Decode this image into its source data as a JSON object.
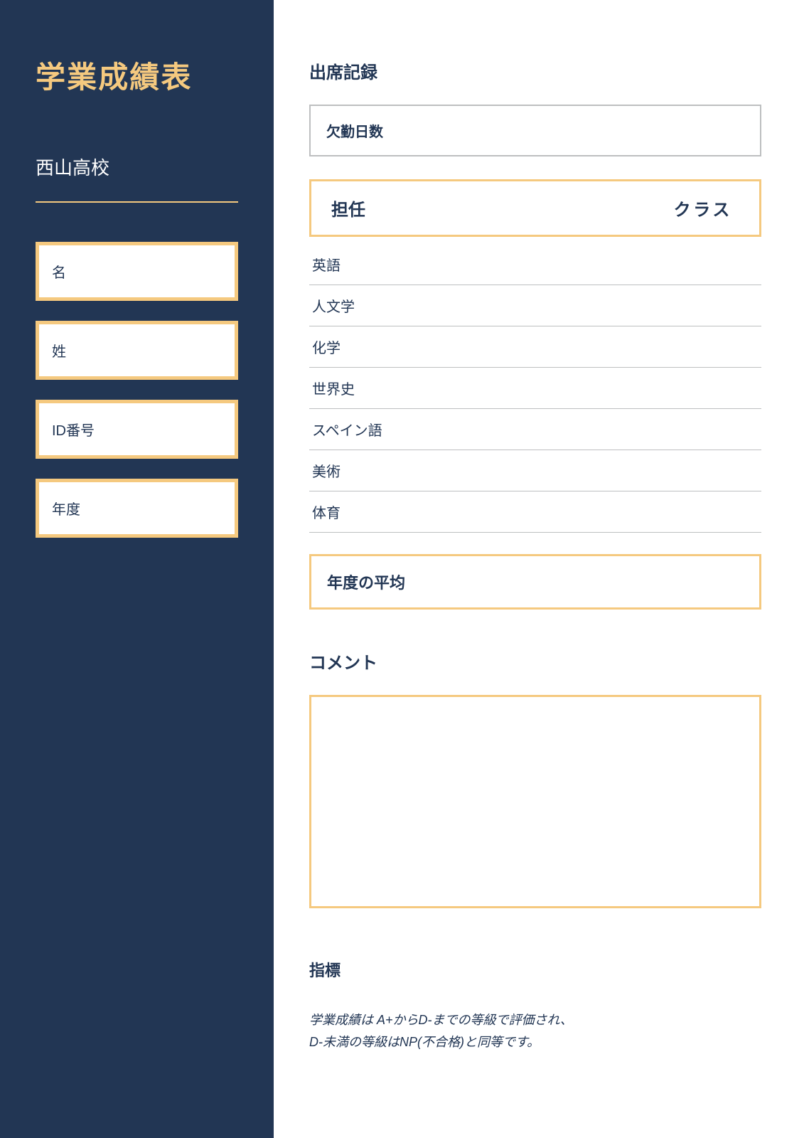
{
  "sidebar": {
    "title": "学業成績表",
    "school": "西山高校",
    "fields": {
      "first_name": "名",
      "last_name": "姓",
      "id_number": "ID番号",
      "year": "年度"
    }
  },
  "main": {
    "attendance_title": "出席記録",
    "absence_label": "欠勤日数",
    "teacher_label": "担任",
    "class_label": "クラス",
    "subjects": [
      "英語",
      "人文学",
      "化学",
      "世界史",
      "スペイン語",
      "美術",
      "体育"
    ],
    "year_avg_label": "年度の平均",
    "comments_title": "コメント",
    "metrics_title": "指標",
    "metrics_text_line1": "学業成績は A+からD-までの等級で評価され、",
    "metrics_text_line2": "D-未満の等級はNP(不合格)と同等です。"
  }
}
